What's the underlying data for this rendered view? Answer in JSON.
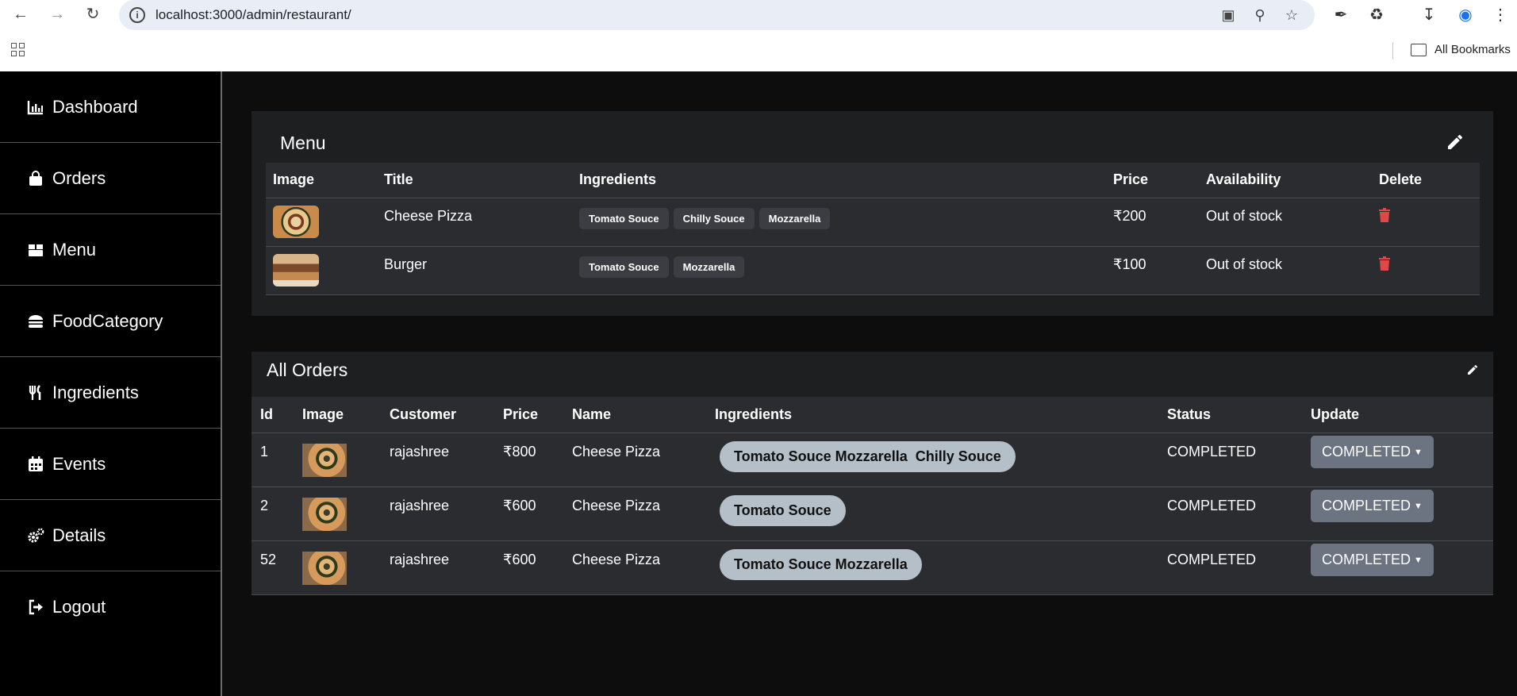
{
  "browser": {
    "url": "localhost:3000/admin/restaurant/",
    "bookmarks_label": "All Bookmarks"
  },
  "sidebar": {
    "items": [
      {
        "label": "Dashboard",
        "icon": "chart-icon"
      },
      {
        "label": "Orders",
        "icon": "shopping-bag-icon"
      },
      {
        "label": "Menu",
        "icon": "menu-box-icon"
      },
      {
        "label": "FoodCategory",
        "icon": "burger-icon"
      },
      {
        "label": "Ingredients",
        "icon": "utensils-icon"
      },
      {
        "label": "Events",
        "icon": "calendar-icon"
      },
      {
        "label": "Details",
        "icon": "gears-icon"
      },
      {
        "label": "Logout",
        "icon": "logout-icon"
      }
    ]
  },
  "menu": {
    "title": "Menu",
    "columns": [
      "Image",
      "Title",
      "Ingredients",
      "Price",
      "Availability",
      "Delete"
    ],
    "rows": [
      {
        "title": "Cheese Pizza",
        "ingredients": [
          "Tomato Souce",
          "Chilly Souce",
          "Mozzarella"
        ],
        "price": "₹200",
        "availability": "Out of stock"
      },
      {
        "title": "Burger",
        "ingredients": [
          "Tomato Souce",
          "Mozzarella"
        ],
        "price": "₹100",
        "availability": "Out of stock"
      }
    ]
  },
  "orders": {
    "title": "All Orders",
    "columns": [
      "Id",
      "Image",
      "Customer",
      "Price",
      "Name",
      "Ingredients",
      "Status",
      "Update"
    ],
    "rows": [
      {
        "id": "1",
        "customer": "rajashree",
        "price": "₹800",
        "name": "Cheese Pizza",
        "ingredients": "Tomato Souce Mozzarella  Chilly Souce",
        "status": "COMPLETED",
        "update": "COMPLETED"
      },
      {
        "id": "2",
        "customer": "rajashree",
        "price": "₹600",
        "name": "Cheese Pizza",
        "ingredients": "Tomato Souce",
        "status": "COMPLETED",
        "update": "COMPLETED"
      },
      {
        "id": "52",
        "customer": "rajashree",
        "price": "₹600",
        "name": "Cheese Pizza",
        "ingredients": "Tomato Souce Mozzarella",
        "status": "COMPLETED",
        "update": "COMPLETED"
      }
    ]
  },
  "colors": {
    "background": "#0d0d0e",
    "sidebar": "#000000",
    "card": "#1e1f21",
    "table": "#2a2c30",
    "chip": "#3b3d42",
    "pill": "#b4bfc7",
    "status_button": "#6b7480",
    "trash": "#e04848"
  }
}
